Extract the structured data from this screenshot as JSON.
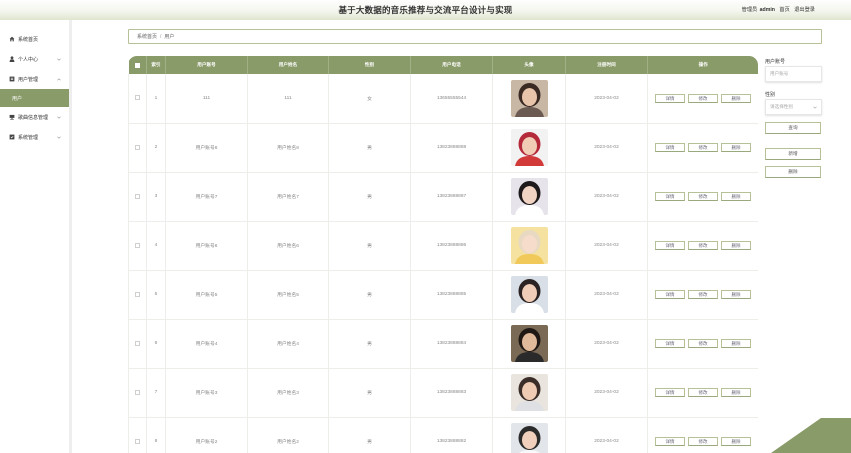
{
  "header": {
    "title": "基于大数据的音乐推荐与交流平台设计与实现",
    "role": "管理员",
    "username": "admin",
    "home_link": "首页",
    "logout_link": "退出登录"
  },
  "sidebar": {
    "items": [
      {
        "label": "系统首页",
        "icon": "home-icon"
      },
      {
        "label": "个人中心",
        "icon": "user-icon"
      },
      {
        "label": "用户管理",
        "icon": "users-icon"
      },
      {
        "label": "用户",
        "icon": ""
      },
      {
        "label": "歌曲信息管理",
        "icon": "music-icon"
      },
      {
        "label": "系统管理",
        "icon": "settings-icon"
      }
    ]
  },
  "breadcrumb": {
    "home": "系统首页",
    "separator": "/",
    "current": "用户"
  },
  "table": {
    "columns": [
      "索引",
      "用户账号",
      "用户姓名",
      "性别",
      "用户电话",
      "头像",
      "注册时间",
      "操作"
    ],
    "rows": [
      {
        "index": "1",
        "account": "111",
        "name": "111",
        "gender": "女",
        "phone": "13655555544",
        "date": "2023-04-02"
      },
      {
        "index": "2",
        "account": "用户账号8",
        "name": "用户姓名8",
        "gender": "男",
        "phone": "13823888888",
        "date": "2023-04-02"
      },
      {
        "index": "3",
        "account": "用户账号7",
        "name": "用户姓名7",
        "gender": "男",
        "phone": "13823888887",
        "date": "2023-04-02"
      },
      {
        "index": "4",
        "account": "用户账号6",
        "name": "用户姓名6",
        "gender": "男",
        "phone": "13823888886",
        "date": "2023-04-02"
      },
      {
        "index": "5",
        "account": "用户账号5",
        "name": "用户姓名5",
        "gender": "男",
        "phone": "13823888885",
        "date": "2023-04-02"
      },
      {
        "index": "6",
        "account": "用户账号4",
        "name": "用户姓名4",
        "gender": "男",
        "phone": "13823888884",
        "date": "2023-04-02"
      },
      {
        "index": "7",
        "account": "用户账号3",
        "name": "用户姓名3",
        "gender": "男",
        "phone": "13823888883",
        "date": "2023-04-02"
      },
      {
        "index": "8",
        "account": "用户账号2",
        "name": "用户姓名2",
        "gender": "男",
        "phone": "13823888882",
        "date": "2023-04-02"
      }
    ],
    "actions": {
      "detail": "详情",
      "edit": "修改",
      "delete": "删除"
    }
  },
  "search": {
    "account_label": "用户账号",
    "account_placeholder": "用户账号",
    "gender_label": "性别",
    "gender_placeholder": "请选择性别",
    "search_button": "查询",
    "add_button": "新增",
    "delete_button": "删除"
  },
  "colors": {
    "accent": "#8a9b6a",
    "border": "#b6c197",
    "header_gradient_end": "#dfe6cf"
  }
}
